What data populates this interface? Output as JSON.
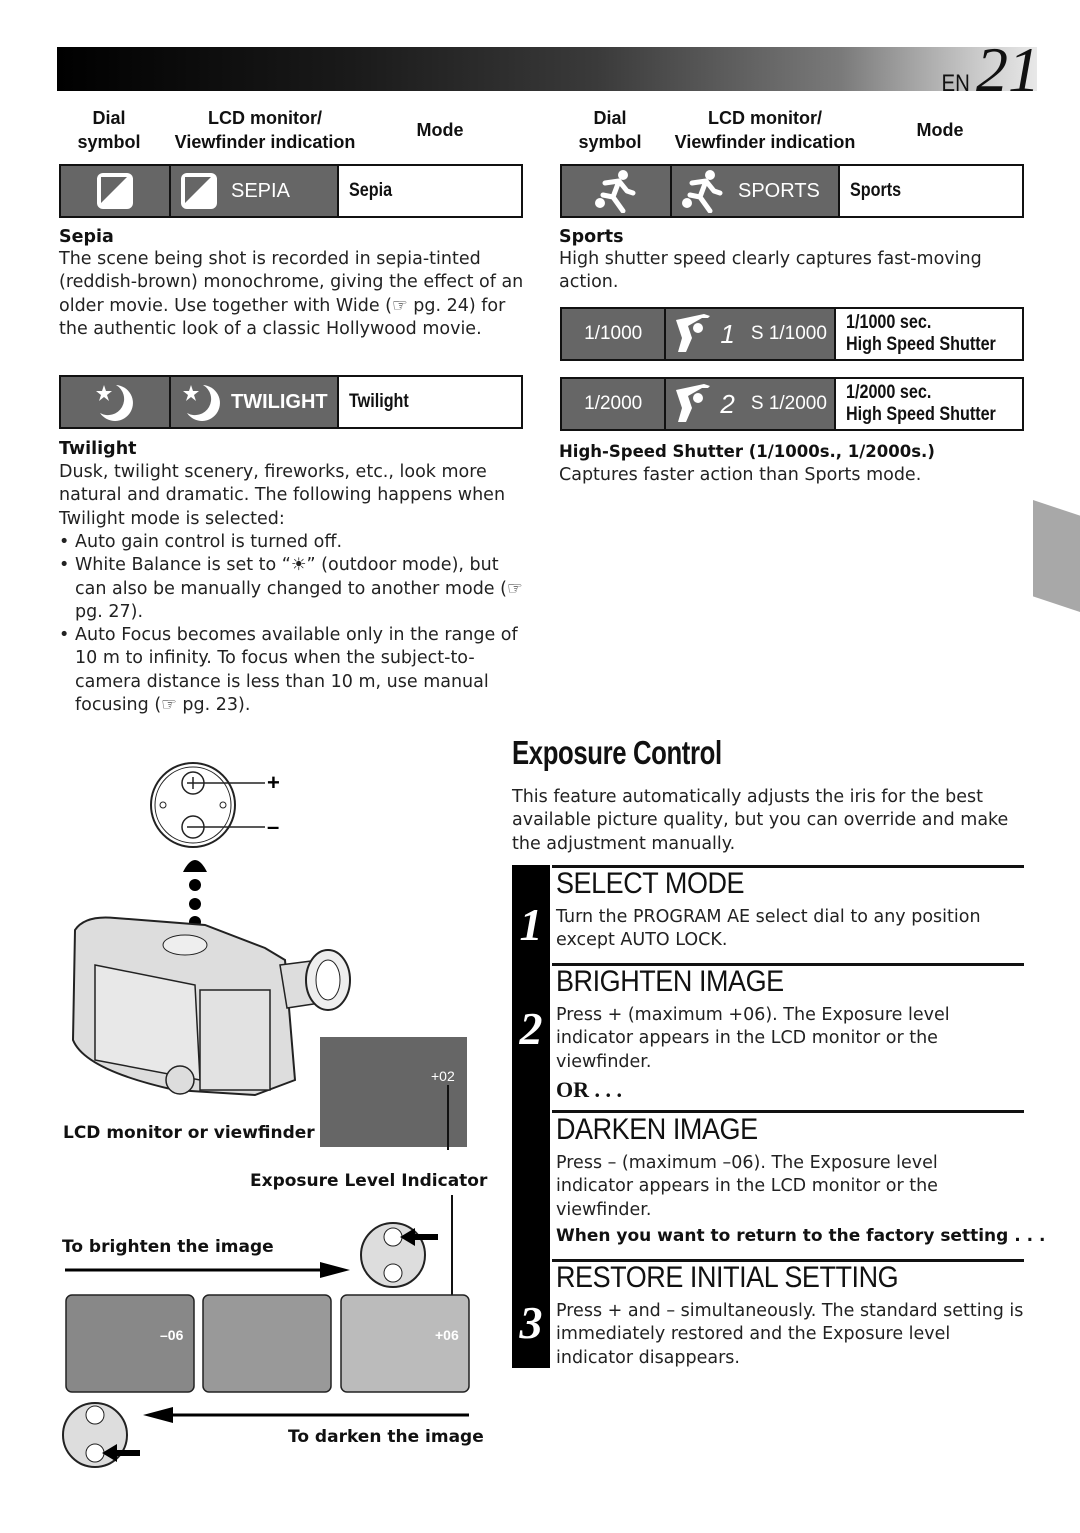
{
  "header": {
    "lang": "EN",
    "page_number": "21"
  },
  "left_table_head": {
    "dial": "Dial\nsymbol",
    "lcd": "LCD monitor/\nViewfinder indication",
    "mode": "Mode"
  },
  "right_table_head": {
    "dial": "Dial\nsymbol",
    "lcd": "LCD monitor/\nViewfinder indication",
    "mode": "Mode"
  },
  "modes": {
    "sepia": {
      "icon": "sepia-icon",
      "indication": "SEPIA",
      "mode": "Sepia"
    },
    "twilight": {
      "icon": "twilight-icon",
      "indication": "TWILIGHT",
      "mode": "Twilight"
    },
    "sports": {
      "icon": "sports-icon",
      "indication": "SPORTS",
      "mode": "Sports"
    },
    "hs1000": {
      "dial": "1/1000",
      "icon": "golfer-icon",
      "digit": "1",
      "indication": "S 1/1000",
      "mode_line1": "1/1000 sec.",
      "mode_line2": "High Speed Shutter"
    },
    "hs2000": {
      "dial": "1/2000",
      "icon": "golfer-icon",
      "digit": "2",
      "indication": "S 1/2000",
      "mode_line1": "1/2000 sec.",
      "mode_line2": "High Speed Shutter"
    }
  },
  "sepia_section": {
    "heading": "Sepia",
    "text": "The scene being shot is recorded in sepia-tinted (reddish-brown) monochrome, giving the effect of an older movie. Use together with Wide (☞ pg. 24) for the authentic look of a classic Hollywood movie."
  },
  "twilight_section": {
    "heading": "Twilight",
    "text": "Dusk, twilight scenery, fireworks, etc., look more natural and dramatic. The following happens when Twilight mode is selected:",
    "bullets": [
      "Auto gain control is turned off.",
      "White Balance is set to “☀” (outdoor mode), but can also be manually changed to another mode (☞ pg. 27).",
      "Auto Focus becomes available only in the range of 10 m to infinity. To focus when the subject-to-camera distance is less than 10 m, use manual focusing (☞ pg. 23)."
    ]
  },
  "sports_section": {
    "heading": "Sports",
    "text": "High shutter speed clearly captures fast-moving action."
  },
  "hs_section": {
    "heading": "High-Speed Shutter (1/1000s., 1/2000s.)",
    "text": "Captures faster action than Sports mode."
  },
  "exposure": {
    "title": "Exposure Control",
    "intro": "This feature automatically adjusts the iris for the best available picture quality, but you can override and make the adjustment manually.",
    "steps": [
      {
        "num": "1",
        "heading": "SELECT MODE",
        "text": "Turn the PROGRAM AE select dial to any position except AUTO LOCK."
      },
      {
        "num": "2",
        "heading": "BRIGHTEN IMAGE",
        "text": "Press + (maximum +06). The Exposure level indicator appears in the LCD monitor or the viewfinder.",
        "or": "OR . . .",
        "heading2": "DARKEN IMAGE",
        "text2": "Press – (maximum –06). The Exposure level indicator appears in the LCD monitor or the viewfinder.",
        "note": "When you want to return to the factory setting . . ."
      },
      {
        "num": "3",
        "heading": "RESTORE INITIAL SETTING",
        "text": "Press + and – simultaneously. The standard setting is immediately restored and the Exposure level indicator disappears."
      }
    ]
  },
  "diagram": {
    "plus": "+",
    "minus": "–",
    "lcd_label": "LCD monitor or viewfinder",
    "lcd_value": "+02",
    "indicator_label": "Exposure Level Indicator",
    "brighten_label": "To brighten the image",
    "darken_label": "To darken the image",
    "frames": [
      "–06",
      "",
      "+06"
    ]
  },
  "colors": {
    "cell_gray": "#666666",
    "side_tab": "#a8a8a8"
  }
}
